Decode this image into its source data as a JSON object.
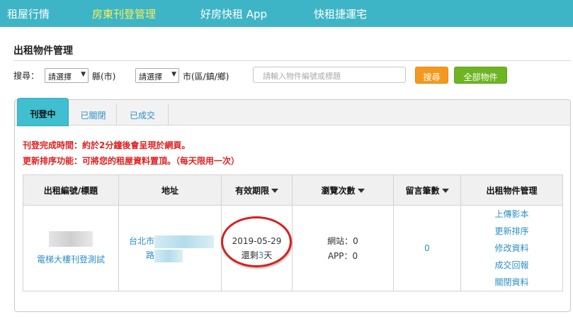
{
  "nav": {
    "items": [
      {
        "label": "租屋行情",
        "active": false
      },
      {
        "label": "房東刊登管理",
        "active": true
      },
      {
        "label": "好房快租 App",
        "active": false
      },
      {
        "label": "快租捷運宅",
        "active": false
      }
    ]
  },
  "page": {
    "title": "出租物件管理"
  },
  "search": {
    "label": "搜尋：",
    "county_select": "請選擇",
    "county_suffix": "縣(市)",
    "district_select": "請選擇",
    "district_suffix": "市(區/鎮/鄉)",
    "placeholder": "請輸入物件編號或標題",
    "search_button": "搜尋",
    "all_button": "全部物件"
  },
  "tabs": [
    {
      "label": "刊登中",
      "active": true
    },
    {
      "label": "已關閉",
      "active": false
    },
    {
      "label": "已成交",
      "active": false
    }
  ],
  "notices": [
    "刊登完成時間：約於2分鐘後會呈現於網頁。",
    "更新排序功能：可將您的租屋資料置頂。（每天限用一次）"
  ],
  "table": {
    "headers": [
      "出租編號/標題",
      "地址",
      "有效期限",
      "瀏覽次數",
      "留言筆數",
      "出租物件管理"
    ],
    "row": {
      "title": "電梯大樓刊登測試",
      "address_line1": "台北市",
      "address_line2": "路",
      "expiry_date": "2019-05-29",
      "days_left_prefix": "還剩",
      "days_left_number": "3",
      "days_left_suffix": "天",
      "views_web": "網站：0",
      "views_app": "APP：0",
      "messages": "0",
      "actions": [
        "上傳影本",
        "更新排序",
        "修改資料",
        "成交回報",
        "關閉資料"
      ]
    }
  },
  "colors": {
    "nav_bg": "#3eb5c6",
    "nav_active": "#f7f05a",
    "tab_active": "#3fbfcf",
    "search_button": "#f39a1e",
    "all_button": "#6fb523",
    "notice_text": "#e02020",
    "link": "#2c8fc6",
    "annotation_circle": "#d81e1e"
  }
}
